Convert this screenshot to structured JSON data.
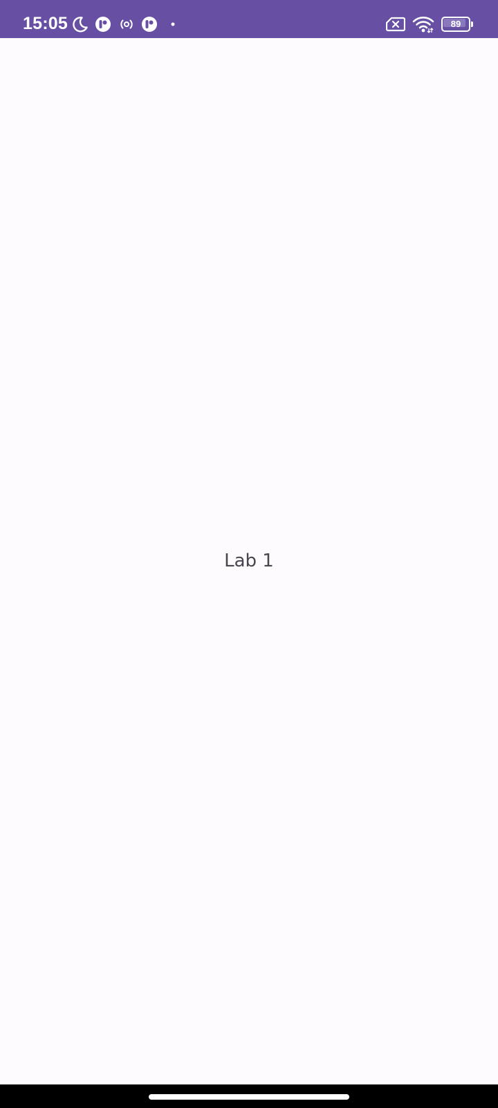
{
  "status_bar": {
    "time": "15:05",
    "battery_level": "89",
    "battery_fraction": 0.89,
    "background_color": "#6750a4",
    "icons_left": [
      "moon-icon",
      "app-notification-icon",
      "hotspot-icon",
      "app-notification-icon",
      "dot-icon"
    ],
    "icons_right": [
      "no-sim-icon",
      "wifi-icon",
      "battery-icon"
    ]
  },
  "main": {
    "label": "Lab 1",
    "background_color": "#fefbfe"
  }
}
